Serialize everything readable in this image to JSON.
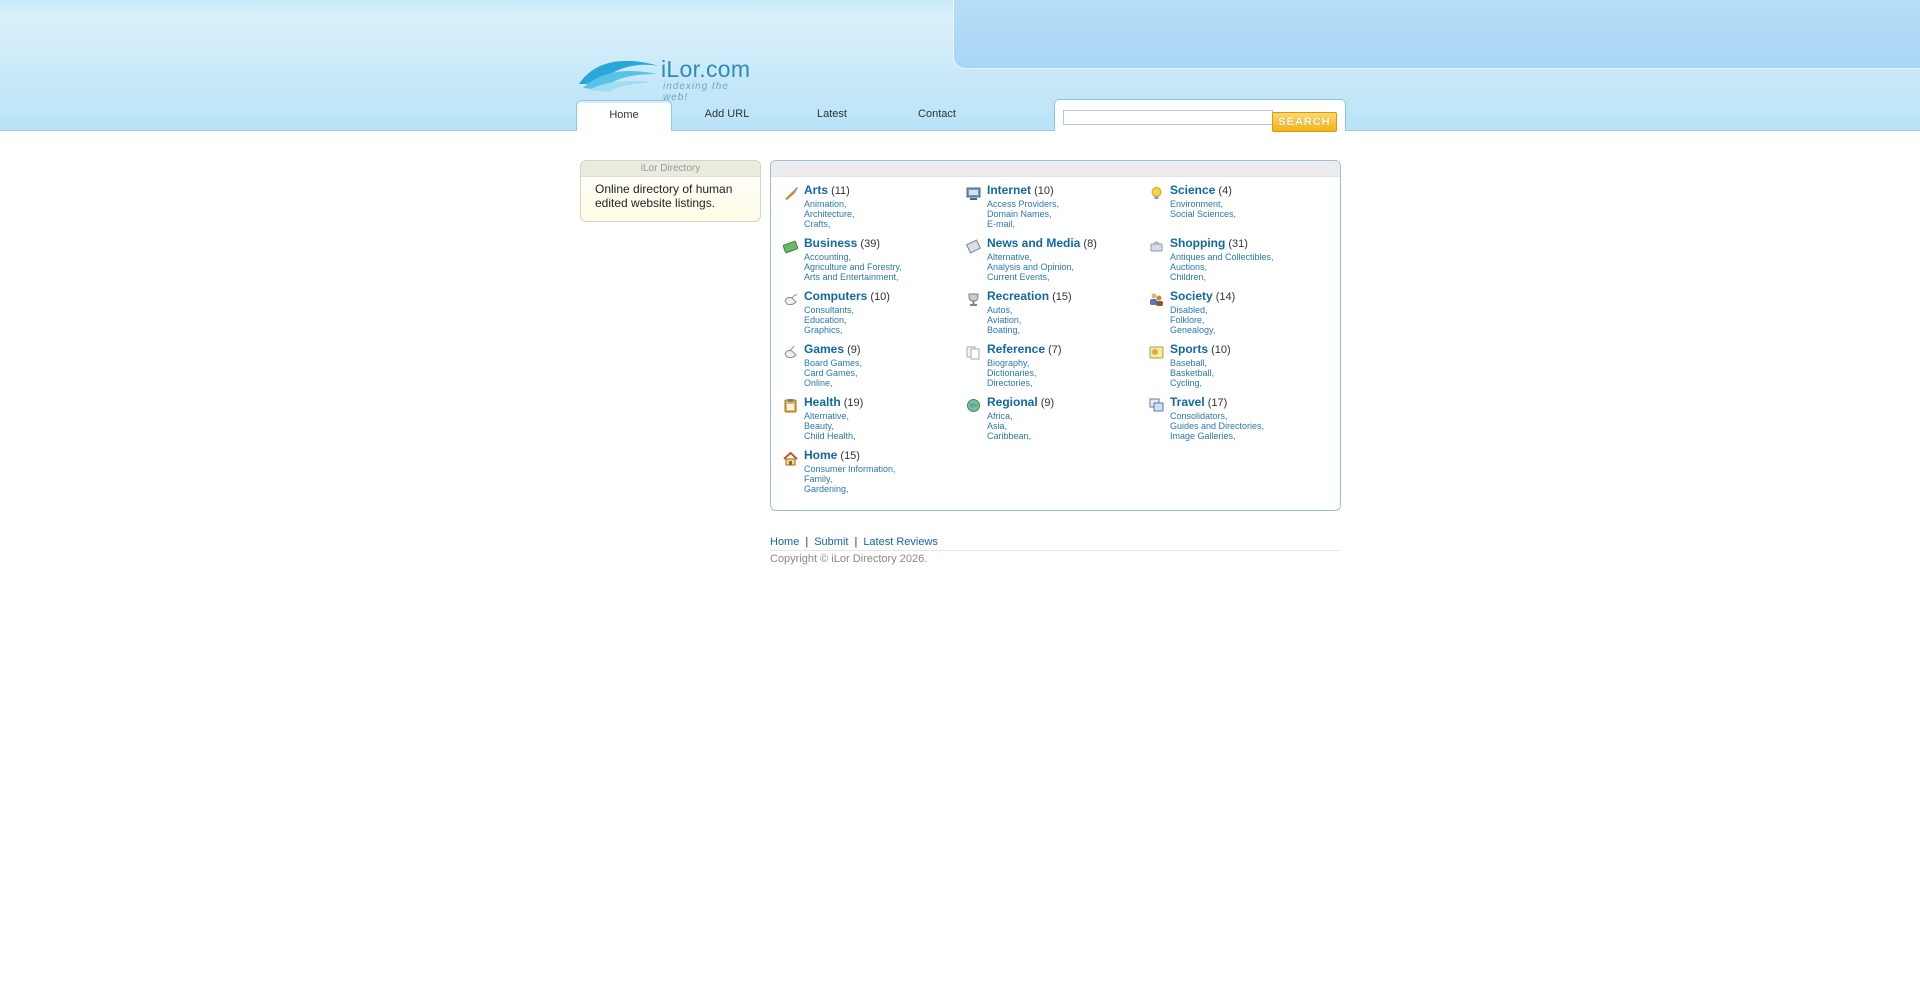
{
  "header": {
    "logo_text": "iLor.com",
    "logo_tagline": "indexing the web!",
    "nav": [
      {
        "label": "Home",
        "active": true
      },
      {
        "label": "Add URL",
        "active": false
      },
      {
        "label": "Latest",
        "active": false
      },
      {
        "label": "Contact",
        "active": false
      }
    ],
    "search": {
      "value": "",
      "button_label": "SEARCH"
    }
  },
  "sidebar": {
    "title": "iLor Directory",
    "text": "Online directory of human edited website listings."
  },
  "categories": [
    {
      "name": "Arts",
      "count": "(11)",
      "icon": "brush-icon",
      "subs": [
        "Animation,",
        "Architecture,",
        "Crafts,"
      ]
    },
    {
      "name": "Internet",
      "count": "(10)",
      "icon": "computer-icon",
      "subs": [
        "Access Providers,",
        "Domain Names,",
        "E-mail,"
      ]
    },
    {
      "name": "Science",
      "count": "(4)",
      "icon": "lightbulb-icon",
      "subs": [
        "Environment,",
        "Social Sciences,"
      ]
    },
    {
      "name": "Business",
      "count": "(39)",
      "icon": "money-icon",
      "subs": [
        "Accounting,",
        "Agriculture and Forestry,",
        "Arts and Entertainment,"
      ]
    },
    {
      "name": "News and Media",
      "count": "(8)",
      "icon": "newspaper-icon",
      "subs": [
        "Alternative,",
        "Analysis and Opinion,",
        "Current Events,"
      ]
    },
    {
      "name": "Shopping",
      "count": "(31)",
      "icon": "shopping-bag-icon",
      "subs": [
        "Antiques and Collectibles,",
        "Auctions,",
        "Children,"
      ]
    },
    {
      "name": "Computers",
      "count": "(10)",
      "icon": "mouse-icon",
      "subs": [
        "Consultants,",
        "Education,",
        "Graphics,"
      ]
    },
    {
      "name": "Recreation",
      "count": "(15)",
      "icon": "trophy-icon",
      "subs": [
        "Autos,",
        "Aviation,",
        "Boating,"
      ]
    },
    {
      "name": "Society",
      "count": "(14)",
      "icon": "people-icon",
      "subs": [
        "Disabled,",
        "Folklore,",
        "Genealogy,"
      ]
    },
    {
      "name": "Games",
      "count": "(9)",
      "icon": "joystick-icon",
      "subs": [
        "Board Games,",
        "Card Games,",
        "Online,"
      ]
    },
    {
      "name": "Reference",
      "count": "(7)",
      "icon": "documents-icon",
      "subs": [
        "Biography,",
        "Dictionaries,",
        "Directories,"
      ]
    },
    {
      "name": "Sports",
      "count": "(10)",
      "icon": "sports-icon",
      "subs": [
        "Baseball,",
        "Basketball,",
        "Cycling,"
      ]
    },
    {
      "name": "Health",
      "count": "(19)",
      "icon": "clipboard-icon",
      "subs": [
        "Alternative,",
        "Beauty,",
        "Child Health,"
      ]
    },
    {
      "name": "Regional",
      "count": "(9)",
      "icon": "globe-icon",
      "subs": [
        "Africa,",
        "Asia,",
        "Caribbean,"
      ]
    },
    {
      "name": "Travel",
      "count": "(17)",
      "icon": "windows-icon",
      "subs": [
        "Consolidators,",
        "Guides and Directories,",
        "Image Galleries,"
      ]
    },
    {
      "name": "Home",
      "count": "(15)",
      "icon": "house-icon",
      "subs": [
        "Consumer Information,",
        "Family,",
        "Gardening,"
      ]
    }
  ],
  "footer": {
    "links": [
      "Home",
      "Submit",
      "Latest Reviews"
    ],
    "separator": "|",
    "copyright": "Copyright © iLor Directory 2026."
  },
  "colors": {
    "link": "#1368a0",
    "sublink": "#2a79b0",
    "header": "#c4e7f8",
    "search_button": "#f4b414"
  }
}
